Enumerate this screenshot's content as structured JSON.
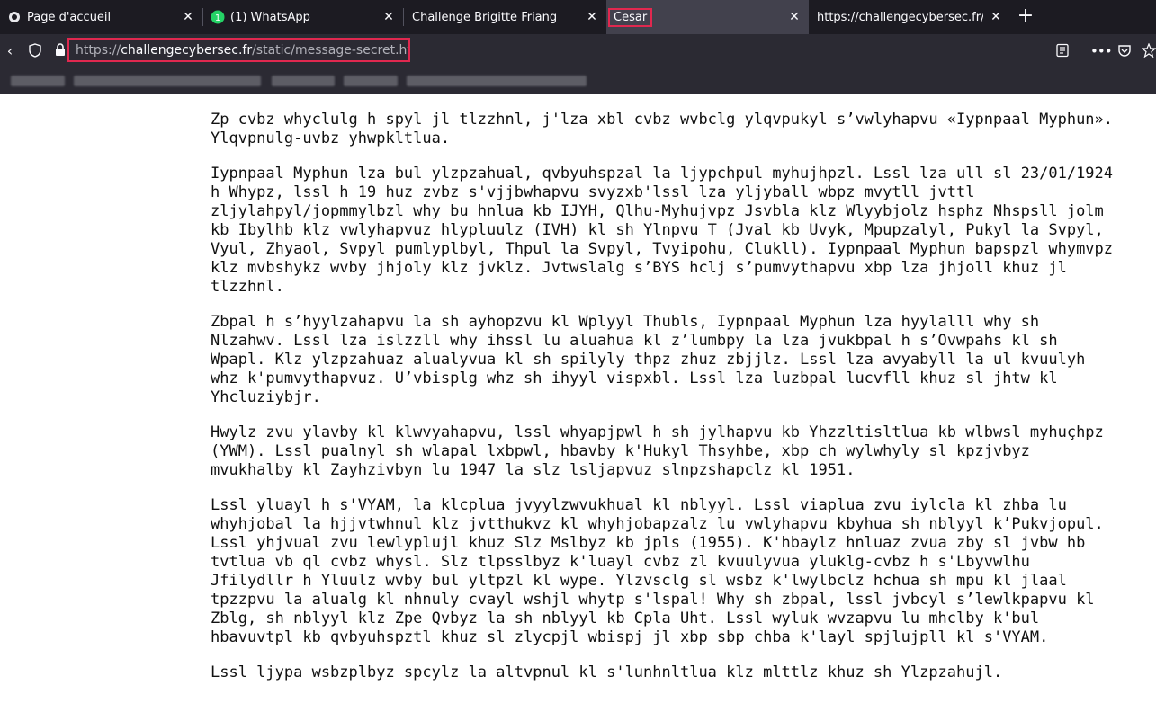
{
  "tabs": [
    {
      "title": "Page d'accueil",
      "icon": "firefox-icon"
    },
    {
      "title": "(1) WhatsApp",
      "icon": "whatsapp-icon",
      "badge": "1"
    },
    {
      "title": "Challenge Brigitte Friang",
      "icon": ""
    },
    {
      "title": "Cesar",
      "icon": ""
    },
    {
      "title": "https://challengecybersec.fr/st",
      "icon": ""
    }
  ],
  "url": {
    "scheme": "https://",
    "host": "challengecybersec.fr",
    "path": "/static/message-secret.html"
  },
  "colors": {
    "highlight": "#e0284f",
    "chrome_bg": "#2b2a33",
    "tabbar_bg": "#1c1b22",
    "whatsapp": "#25d366"
  },
  "paragraphs": [
    "Zp cvbz whyclulg h spyl jl tlzzhnl, j'lza xbl cvbz wvbclg ylqvpukyl s’vwlyhapvu «Iypnpaal Myphun». Ylqvpnulg-uvbz yhwpkltlua.",
    "Iypnpaal Myphun lza bul ylzpzahual, qvbyuhspzal la ljypchpul myhujhpzl. Lssl lza ull sl 23/01/1924 h Whypz, lssl h 19 huz zvbz s'vjjbwhapvu svyzxb'lssl lza yljyball wbpz mvytll jvttl zljylahpyl/jopmmylbzl why bu hnlua kb IJYH, Qlhu-Myhujvpz Jsvbla klz Wlyybjolz hsphz Nhspsll jolm kb Ibylhb klz vwlyhapvuz hlypluulz (IVH) kl sh Ylnpvu T (Jval kb Uvyk, Mpupzalyl, Pukyl la Svpyl, Vyul, Zhyaol, Svpyl pumlyplbyl, Thpul la Svpyl, Tvyipohu, Clukll). Iypnpaal Myphun bapspzl whymvpz klz mvbshykz wvby jhjoly klz jvklz. Jvtwslalg s’BYS hclj s’pumvythapvu xbp lza jhjoll khuz jl tlzzhnl.",
    "Zbpal h s’hyylzahapvu la sh ayhopzvu kl Wplyyl Thubls, Iypnpaal Myphun lza hyylalll why sh Nlzahwv. Lssl lza islzzll why ihssl lu aluahua kl z’lumbpy la lza jvukbpal h s’Ovwpahs kl sh Wpapl. Klz ylzpzahuaz alualyvua kl sh spilyly thpz zhuz zbjjlz. Lssl lza avyabyll la ul kvuulyh whz k'pumvythapvuz. U’vbisplg whz sh ihyyl vispxbl. Lssl lza luzbpal lucvfll khuz sl jhtw kl Yhcluziybjr.",
    "Hwylz zvu ylavby kl klwvyahapvu, lssl whyapjpwl h sh jylhapvu kb Yhzzltisltlua kb wlbwsl myhuçhpz (YWM). Lssl pualnyl sh wlapal lxbpwl, hbavby k'Hukyl Thsyhbe, xbp ch wylwhyly sl kpzjvbyz mvukhalby kl Zayhzivbyn lu 1947 la slz lsljapvuz slnpzshapclz kl 1951.",
    "Lssl yluayl h s'VYAM, la klcplua jvyylzwvukhual kl nblyyl. Lssl viaplua zvu iylcla kl zhba lu whyhjobal la hjjvtwhnul klz jvtthukvz kl whyhjobapzalz lu vwlyhapvu kbyhua sh nblyyl k’Pukvjopul. Lssl yhjvual zvu lewlyplujl khuz Slz Mslbyz kb jpls (1955). K'hbaylz hnluaz zvua zby sl jvbw hb tvtlua vb ql cvbz whysl. Slz tlpsslbyz k'luayl cvbz zl kvuulyvua yluklg-cvbz h s'Lbyvwlhu Jfilydllr h Yluulz wvby bul yltpzl kl wype. Ylzvsclg sl wsbz k'lwylbclz hchua sh mpu kl jlaal tpzzpvu la alualg kl nhnuly cvayl wshjl whytp s'lspal! Why sh zbpal, lssl jvbcyl s’lewlkpapvu kl Zblg, sh nblyyl klz Zpe Qvbyz la sh nblyyl kb Cpla Uht. Lssl wyluk wvzapvu lu mhclby k'bul hbavuvtpl kb qvbyuhspztl khuz sl zlycpjl wbispj jl xbp sbp chba k'layl spjlujpll kl s'VYAM.",
    "Lssl ljypa wsbzplbyz spcylz la altvpnul kl s'lunhnltlua klz mlttlz khuz sh Ylzpzahujl."
  ]
}
